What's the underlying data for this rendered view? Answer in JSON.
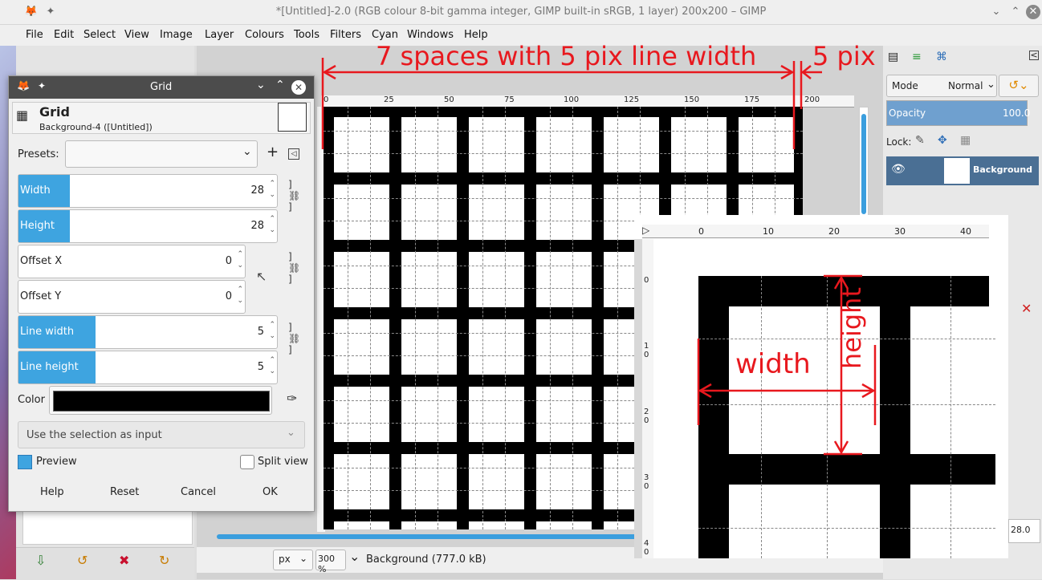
{
  "window": {
    "title": "*[Untitled]-2.0 (RGB colour 8-bit gamma integer, GIMP built-in sRGB, 1 layer) 200x200 – GIMP"
  },
  "menu": [
    "File",
    "Edit",
    "Select",
    "View",
    "Image",
    "Layer",
    "Colours",
    "Tools",
    "Filters",
    "Cyan",
    "Windows",
    "Help"
  ],
  "ruler": {
    "ticks": [
      "0",
      "25",
      "50",
      "75",
      "100",
      "125",
      "150",
      "175",
      "200"
    ]
  },
  "status": {
    "unit": "px",
    "zoom": "300 %",
    "info": "Background (777.0 kB)"
  },
  "dock": {
    "mode_label": "Mode",
    "mode_value": "Normal",
    "opacity_label": "Opacity",
    "opacity_value": "100.0",
    "lock_label": "Lock:",
    "layer_name": "Background",
    "bottom_value": "28.0"
  },
  "dialog": {
    "title": "Grid",
    "header_title": "Grid",
    "header_subtitle": "Background-4 ([Untitled])",
    "presets_label": "Presets:",
    "presets_value": "",
    "fields": [
      {
        "label": "Width",
        "value": "28",
        "highlight": true
      },
      {
        "label": "Height",
        "value": "28",
        "highlight": true
      },
      {
        "label": "Offset X",
        "value": "0",
        "highlight": false
      },
      {
        "label": "Offset Y",
        "value": "0",
        "highlight": false
      },
      {
        "label": "Line width",
        "value": "5",
        "highlight": true
      },
      {
        "label": "Line height",
        "value": "5",
        "highlight": true
      }
    ],
    "color_label": "Color",
    "color_value": "#000000",
    "selection_input": "Use the selection as input",
    "preview_label": "Preview",
    "preview_checked": true,
    "split_label": "Split view",
    "split_checked": false,
    "buttons": [
      "Help",
      "Reset",
      "Cancel",
      "OK"
    ]
  },
  "inset": {
    "ruler_ticks": [
      "0",
      "10",
      "20",
      "30",
      "40"
    ],
    "vruler_ticks": [
      "0",
      "1 0",
      "2 0",
      "3 0",
      "4 0"
    ]
  },
  "annotations": {
    "top_label": "7 spaces with 5 pix line width",
    "right_label": "5 pix",
    "width_label": "width",
    "height_label": "height",
    "color": "#e8181e"
  }
}
